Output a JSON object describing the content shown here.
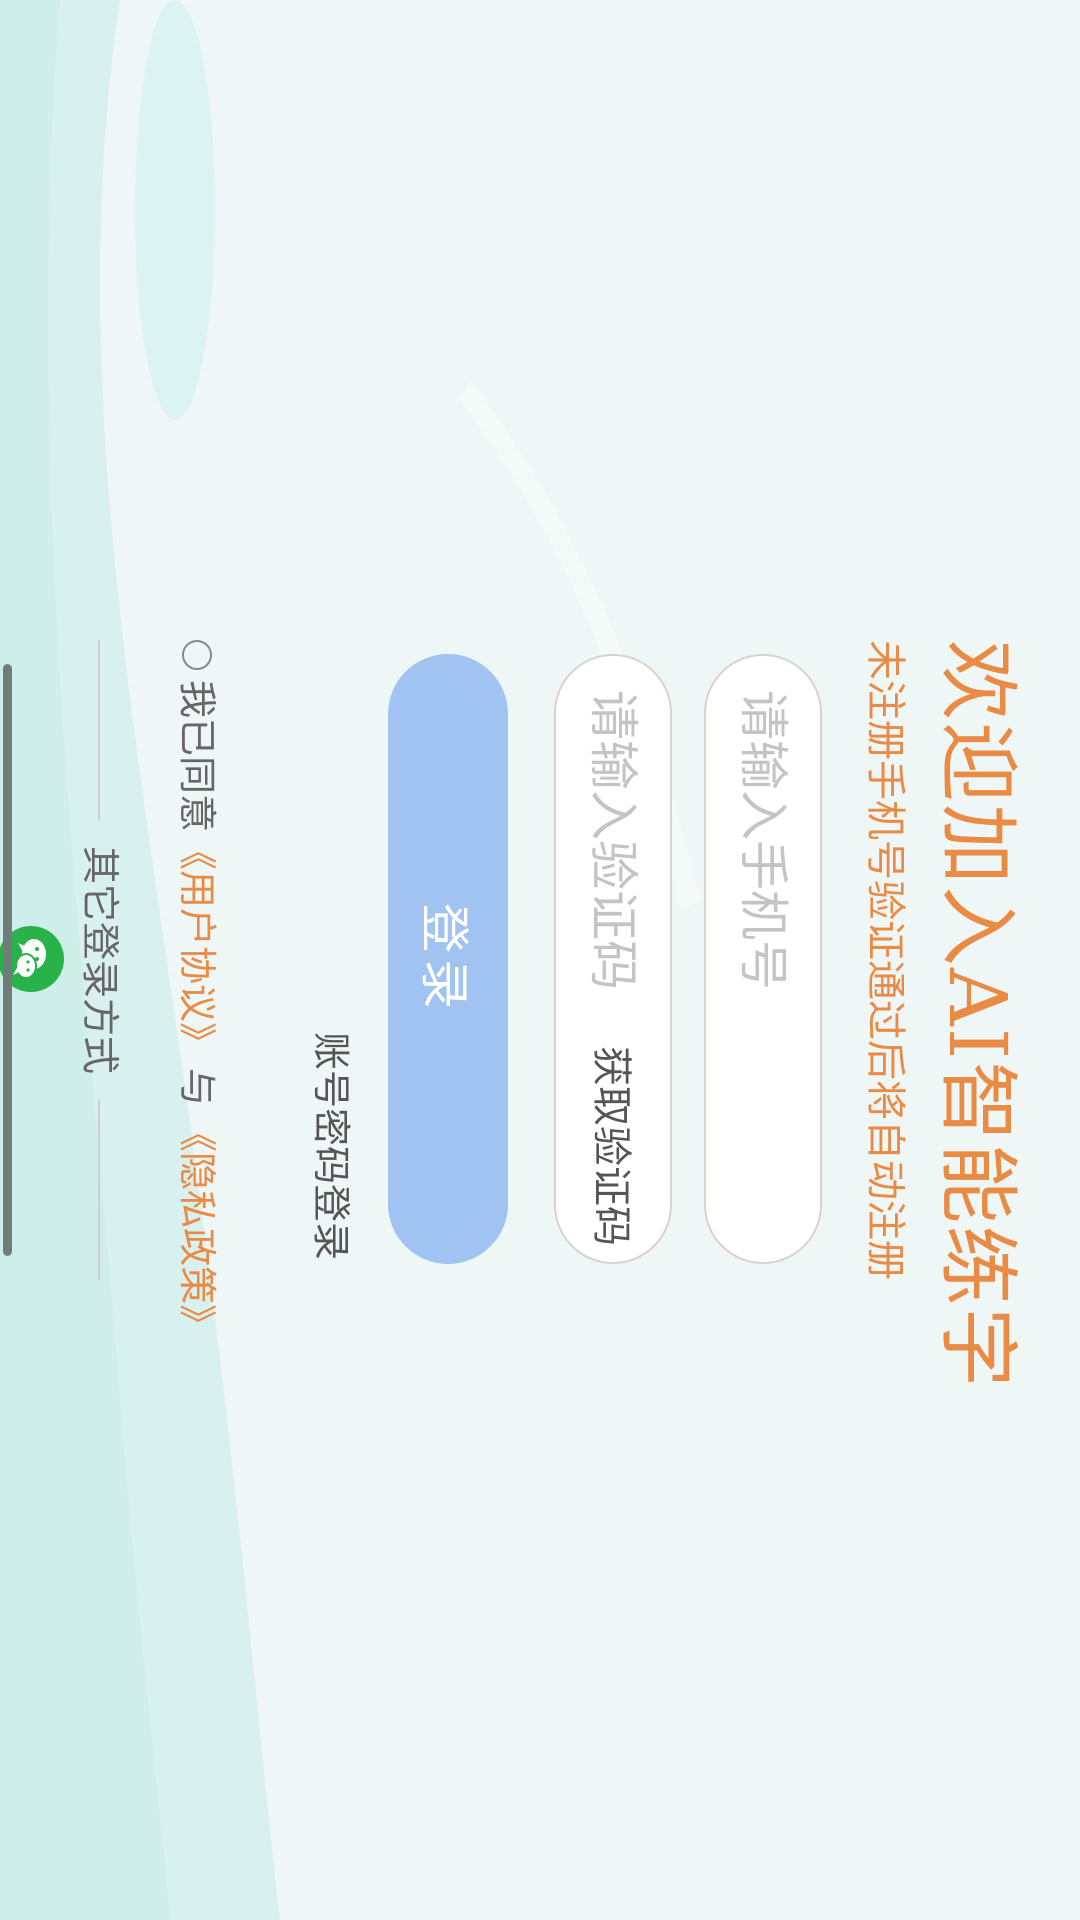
{
  "title": "欢迎加入AI智能练字",
  "subtitle": "未注册手机号验证通过后将自动注册",
  "phone_input": {
    "placeholder": "请输入手机号",
    "value": ""
  },
  "code_input": {
    "placeholder": "请输入验证码",
    "value": "",
    "get_code_label": "获取验证码"
  },
  "login_button_label": "登录",
  "account_login_label": "账号密码登录",
  "agreement": {
    "prefix": "我已同意",
    "user_agreement": "《用户协议》",
    "connector": "与",
    "privacy_policy": "《隐私政策》"
  },
  "other_login_label": "其它登录方式",
  "colors": {
    "accent": "#e98a45",
    "button": "#a0c3f1",
    "wechat": "#2ab24a"
  },
  "icons": {
    "wechat": "wechat-icon",
    "radio": "radio-unchecked-icon"
  }
}
